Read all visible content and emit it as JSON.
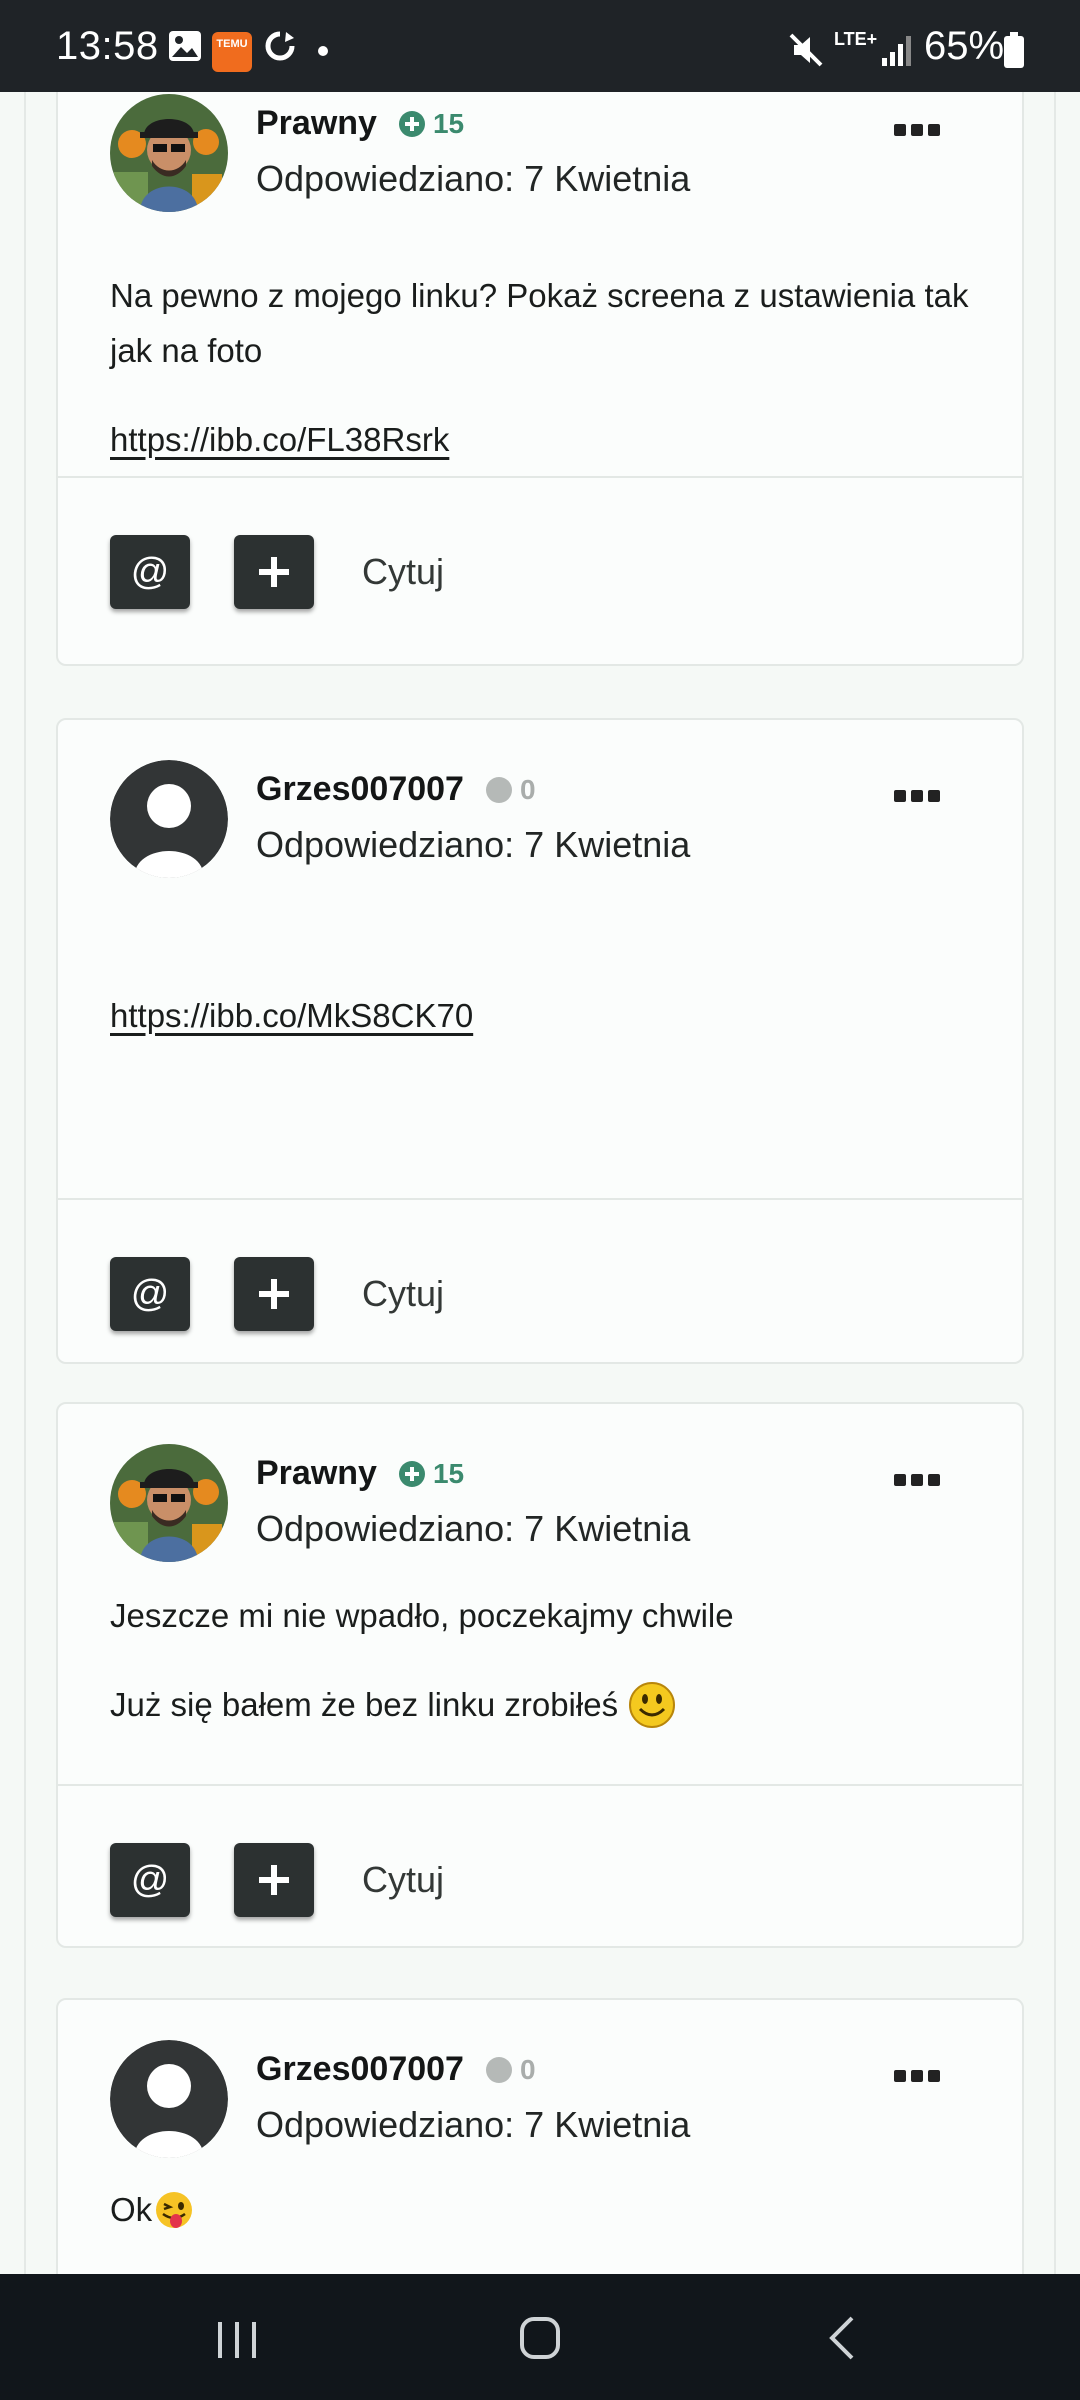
{
  "status_bar": {
    "time": "13:58",
    "temu_label": "TEMU",
    "network": "LTE+",
    "battery": "65%",
    "icons": [
      "gallery-icon",
      "temu-app-icon",
      "sync-icon",
      "notification-dot-icon",
      "mute-icon",
      "lte-icon",
      "signal-icon",
      "battery-icon"
    ]
  },
  "posts": [
    {
      "author": "Prawny",
      "reputation": "15",
      "reputation_type": "positive",
      "posted": "Odpowiedziano: 7 Kwietnia",
      "avatar": "bitcoin-character-avatar",
      "paragraphs": [
        "Na pewno z mojego linku? Pokaż screena z ustawienia tak jak na foto"
      ],
      "link": "https://ibb.co/FL38Rsrk",
      "mention_label": "@",
      "quote_label": "Cytuj"
    },
    {
      "author": "Grzes007007",
      "reputation": "0",
      "reputation_type": "neutral",
      "posted": "Odpowiedziano: 7 Kwietnia",
      "avatar": "default-avatar",
      "link": "https://ibb.co/MkS8CK70",
      "mention_label": "@",
      "quote_label": "Cytuj"
    },
    {
      "author": "Prawny",
      "reputation": "15",
      "reputation_type": "positive",
      "posted": "Odpowiedziano: 7 Kwietnia",
      "avatar": "bitcoin-character-avatar",
      "paragraphs": [
        "Jeszcze mi nie wpadło, poczekajmy chwile",
        "Już się bałem że bez linku zrobiłeś"
      ],
      "mention_label": "@",
      "quote_label": "Cytuj"
    },
    {
      "author": "Grzes007007",
      "reputation": "0",
      "reputation_type": "neutral",
      "posted": "Odpowiedziano: 7 Kwietnia",
      "avatar": "default-avatar",
      "paragraphs": [
        "Ok"
      ]
    }
  ],
  "nav_bar": {
    "buttons": [
      "recent-apps-icon",
      "home-icon",
      "back-icon"
    ]
  },
  "colors": {
    "reputation_positive": "#3b8a6e",
    "reputation_neutral": "#b5b9b7",
    "button_dark": "#2c3131",
    "status_bar": "#1f2327"
  }
}
